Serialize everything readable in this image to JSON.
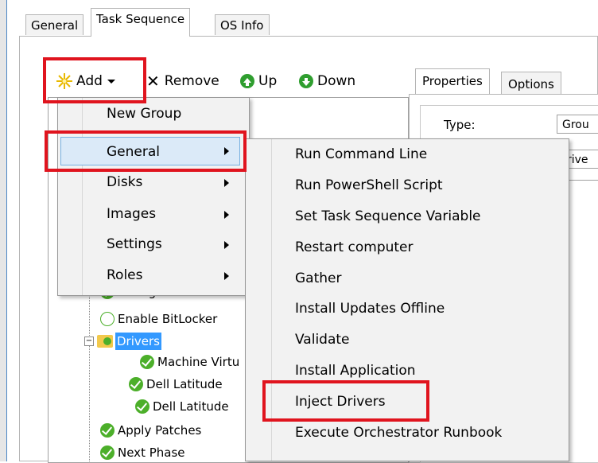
{
  "tabs": [
    {
      "label": "General"
    },
    {
      "label": "Task Sequence"
    },
    {
      "label": "OS Info"
    }
  ],
  "toolbar": {
    "add_label": "Add",
    "remove_label": "Remove",
    "up_label": "Up",
    "down_label": "Down"
  },
  "add_menu": {
    "items": [
      {
        "label": "New Group",
        "submenu": false
      },
      {
        "label": "General",
        "submenu": true
      },
      {
        "label": "Disks",
        "submenu": true
      },
      {
        "label": "Images",
        "submenu": true
      },
      {
        "label": "Settings",
        "submenu": true
      },
      {
        "label": "Roles",
        "submenu": true
      }
    ]
  },
  "general_submenu": {
    "items": [
      {
        "label": "Run Command Line"
      },
      {
        "label": "Run PowerShell Script"
      },
      {
        "label": "Set Task Sequence Variable"
      },
      {
        "label": "Restart computer"
      },
      {
        "label": "Gather"
      },
      {
        "label": "Install Updates Offline"
      },
      {
        "label": "Validate"
      },
      {
        "label": "Install Application"
      },
      {
        "label": "Inject Drivers"
      },
      {
        "label": "Execute Orchestrator Runbook"
      }
    ]
  },
  "tree": {
    "items": [
      {
        "label": "Configure"
      },
      {
        "label": "Enable BitLocker"
      },
      {
        "label": "Drivers"
      },
      {
        "label": "Machine Virtu"
      },
      {
        "label": "Dell Latitude"
      },
      {
        "label": "Dell Latitude"
      },
      {
        "label": "Apply Patches"
      },
      {
        "label": "Next Phase"
      }
    ]
  },
  "properties": {
    "tab_properties": "Properties",
    "tab_options": "Options",
    "type_label": "Type:",
    "type_value": "Grou",
    "name_value": "rive"
  },
  "colors": {
    "highlight_red": "#e0141e",
    "selection_blue": "#3399ff",
    "check_green": "#4caf2a"
  }
}
